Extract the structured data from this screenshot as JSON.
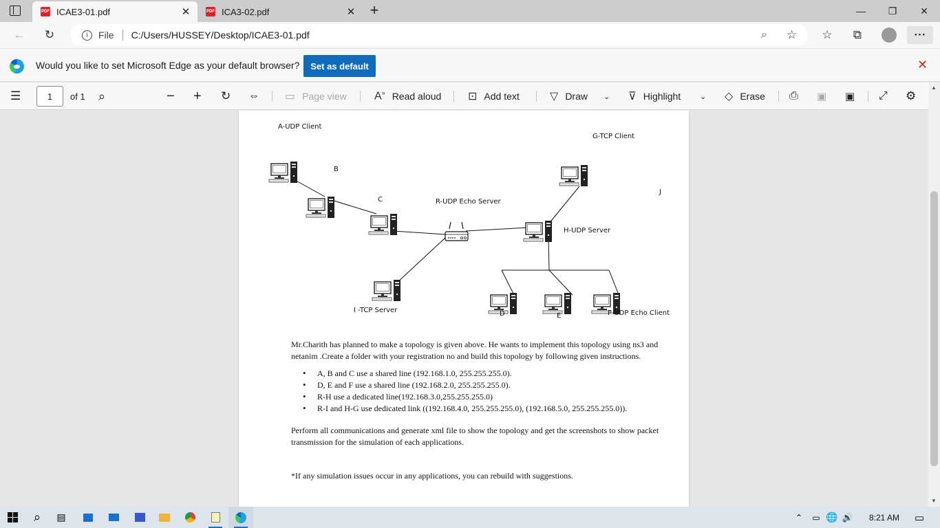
{
  "tabs": [
    {
      "title": "ICAE3-01.pdf",
      "icon": "pdf-icon",
      "active": true
    },
    {
      "title": "ICA3-02.pdf",
      "icon": "pdf-icon",
      "active": false
    }
  ],
  "tab_close_glyph": "✕",
  "new_tab_glyph": "+",
  "window_controls": {
    "minimize": "—",
    "restore": "❐",
    "close": "✕"
  },
  "address": {
    "info_label": "File",
    "url": "C:/Users/HUSSEY/Desktop/ICAE3-01.pdf"
  },
  "infobar": {
    "message": "Would you like to set Microsoft Edge as your default browser?",
    "button": "Set as default",
    "close": "✕"
  },
  "pdf_toolbar": {
    "page_number": "1",
    "page_total": "of 1",
    "page_view": "Page view",
    "read_aloud": "Read aloud",
    "add_text": "Add text",
    "draw": "Draw",
    "highlight": "Highlight",
    "erase": "Erase"
  },
  "diagram": {
    "labels": {
      "a": "A-UDP Client",
      "g": "G-TCP Client",
      "b": "B",
      "c": "C",
      "j": "J",
      "r": "R-UDP Echo Server",
      "h": "H-UDP Server",
      "i": "I -TCP Server",
      "d": "D",
      "e": "E",
      "f": "F-UDP Echo Client"
    }
  },
  "document": {
    "intro": "Mr.Charith has planned to make a topology is given above. He wants to implement this topology using ns3 and netanim .Create a folder with your registration no and build this topology by following given instructions.",
    "bullets": [
      "A, B and C use a shared line (192.168.1.0, 255.255.255.0).",
      "D, E and F use a shared line (192.168.2.0, 255.255.255.0).",
      "R-H use a dedicated line(192.168.3.0,255.255.255.0)",
      "R-I and H-G use dedicated link ((192.168.4.0, 255.255.255.0), (192.168.5.0, 255.255.255.0))."
    ],
    "para2": "Perform all communications and generate xml file to show the topology and get the screenshots to show packet transmission for the simulation of each applications.",
    "para3": "*If any simulation issues occur in any applications, you can rebuild with suggestions."
  },
  "taskbar": {
    "time": "8:21 AM"
  },
  "colors": {
    "accent": "#0f6cbd",
    "pdf_red": "#d6262c",
    "tabbar": "#cdcdcd"
  }
}
